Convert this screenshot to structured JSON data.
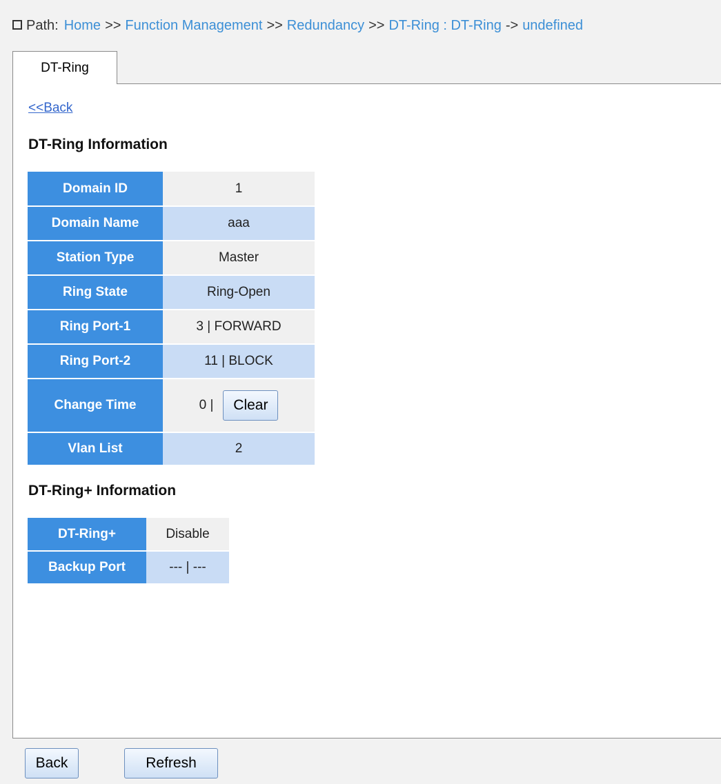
{
  "path": {
    "label": "Path:",
    "crumbs": [
      "Home",
      "Function Management",
      "Redundancy",
      "DT-Ring : DT-Ring",
      "undefined"
    ],
    "separators": [
      ">>",
      ">>",
      ">>",
      "->"
    ]
  },
  "tab": {
    "label": "DT-Ring"
  },
  "back_link": "<<Back",
  "dtring": {
    "title": "DT-Ring Information",
    "rows": [
      {
        "label": "Domain ID",
        "value": "1"
      },
      {
        "label": "Domain Name",
        "value": "aaa"
      },
      {
        "label": "Station Type",
        "value": "Master"
      },
      {
        "label": "Ring State",
        "value": "Ring-Open"
      },
      {
        "label": "Ring Port-1",
        "value": "3 | FORWARD"
      },
      {
        "label": "Ring Port-2",
        "value": "11 | BLOCK"
      },
      {
        "label": "Change Time",
        "value": "0 |",
        "button": "Clear"
      },
      {
        "label": "Vlan List",
        "value": "2"
      }
    ]
  },
  "dtringplus": {
    "title": "DT-Ring+ Information",
    "rows": [
      {
        "label": "DT-Ring+",
        "value": "Disable"
      },
      {
        "label": "Backup Port",
        "value": "--- | ---"
      }
    ]
  },
  "buttons": {
    "back": "Back",
    "refresh": "Refresh"
  },
  "colors": {
    "header_cell": "#3d8fe0",
    "value_alt": "#c9dcf5",
    "link": "#3c8fd6"
  }
}
